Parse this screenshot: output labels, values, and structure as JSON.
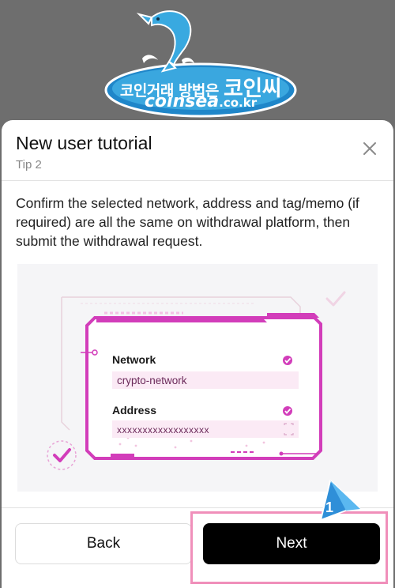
{
  "watermark": {
    "text_kr": "코인거래 방법은",
    "text_kr_big": "코인씨",
    "site_name": "coinsea",
    "site_domain": ".co.kr"
  },
  "dialog": {
    "title": "New user tutorial",
    "subtitle": "Tip 2",
    "body": "Confirm the selected network, address and tag/memo (if required) are all the same on withdrawal platform, then submit the withdrawal request.",
    "illustration": {
      "network_label": "Network",
      "network_value": "crypto-network",
      "address_label": "Address",
      "address_value": "xxxxxxxxxxxxxxxxxx"
    },
    "back_label": "Back",
    "next_label": "Next"
  },
  "annotation": {
    "step_number": "1"
  },
  "colors": {
    "accent": "#d946b8",
    "primary_button": "#000000",
    "highlight": "#f08fba",
    "pointer": "#2f8fd8"
  }
}
